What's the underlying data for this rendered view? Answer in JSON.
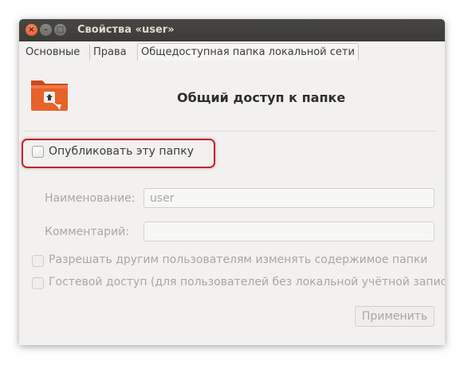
{
  "window": {
    "title": "Свойства «user»",
    "buttons": {
      "close": "×",
      "minimize": "–",
      "maximize": "□"
    }
  },
  "tabs": [
    {
      "label": "Основные",
      "active": false
    },
    {
      "label": "Права",
      "active": false
    },
    {
      "label": "Общедоступная папка локальной сети",
      "active": true
    }
  ],
  "share": {
    "heading": "Общий доступ к папке",
    "folder_icon": "folder-share-icon",
    "publish_label": "Опубликовать эту папку",
    "publish_checked": false,
    "name_label": "Наименование:",
    "name_value": "user",
    "comment_label": "Комментарий:",
    "comment_value": "",
    "allow_edit_label": "Разрешать другим пользователям изменять содержимое папки",
    "guest_label": "Гостевой доступ (для пользователей без локальной учётной записи)",
    "apply_label": "Применить"
  },
  "colors": {
    "titlebar": "#3c3b37",
    "close_button": "#e0552a",
    "highlight_border": "#c5232d",
    "folder_orange": "#e8622a"
  }
}
